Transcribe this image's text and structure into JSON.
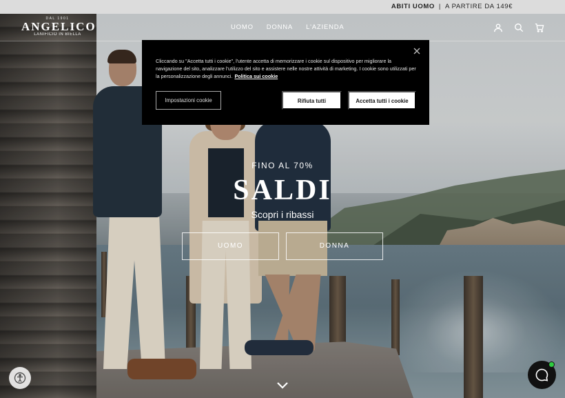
{
  "announcement": {
    "product": "ABITI UOMO",
    "separator": "|",
    "price_text": "A PARTIRE DA 149€"
  },
  "header": {
    "logo": {
      "since": "DAL 1901",
      "name": "ANGELICO",
      "subtitle": "LANIFICIO IN BIELLA"
    },
    "nav": [
      {
        "label": "UOMO"
      },
      {
        "label": "DONNA"
      },
      {
        "label": "L'AZIENDA"
      }
    ],
    "icons": [
      "account-icon",
      "search-icon",
      "cart-icon"
    ]
  },
  "hero": {
    "eyebrow": "FINO AL 70%",
    "title": "SALDI",
    "subtitle": "Scopri i ribassi",
    "buttons": [
      {
        "label": "UOMO"
      },
      {
        "label": "DONNA"
      }
    ]
  },
  "cookie_banner": {
    "text": "Cliccando su \"Accetta tutti i cookie\", l'utente accetta di memorizzare i cookie sul dispositivo per migliorare la navigazione del sito, analizzare l'utilizzo del sito e assistere nelle nostre attività di marketing. I cookie sono utilizzati per la personalizzazione degli annunci.",
    "link": "Politica sui cookie",
    "settings_label": "Impostazioni cookie",
    "reject_label": "Rifiuta tutti",
    "accept_label": "Accetta tutti i cookie"
  },
  "colors": {
    "banner_bg": "#000000",
    "announcement_bg": "#dcdcdc",
    "chat_online": "#2ecc40"
  }
}
